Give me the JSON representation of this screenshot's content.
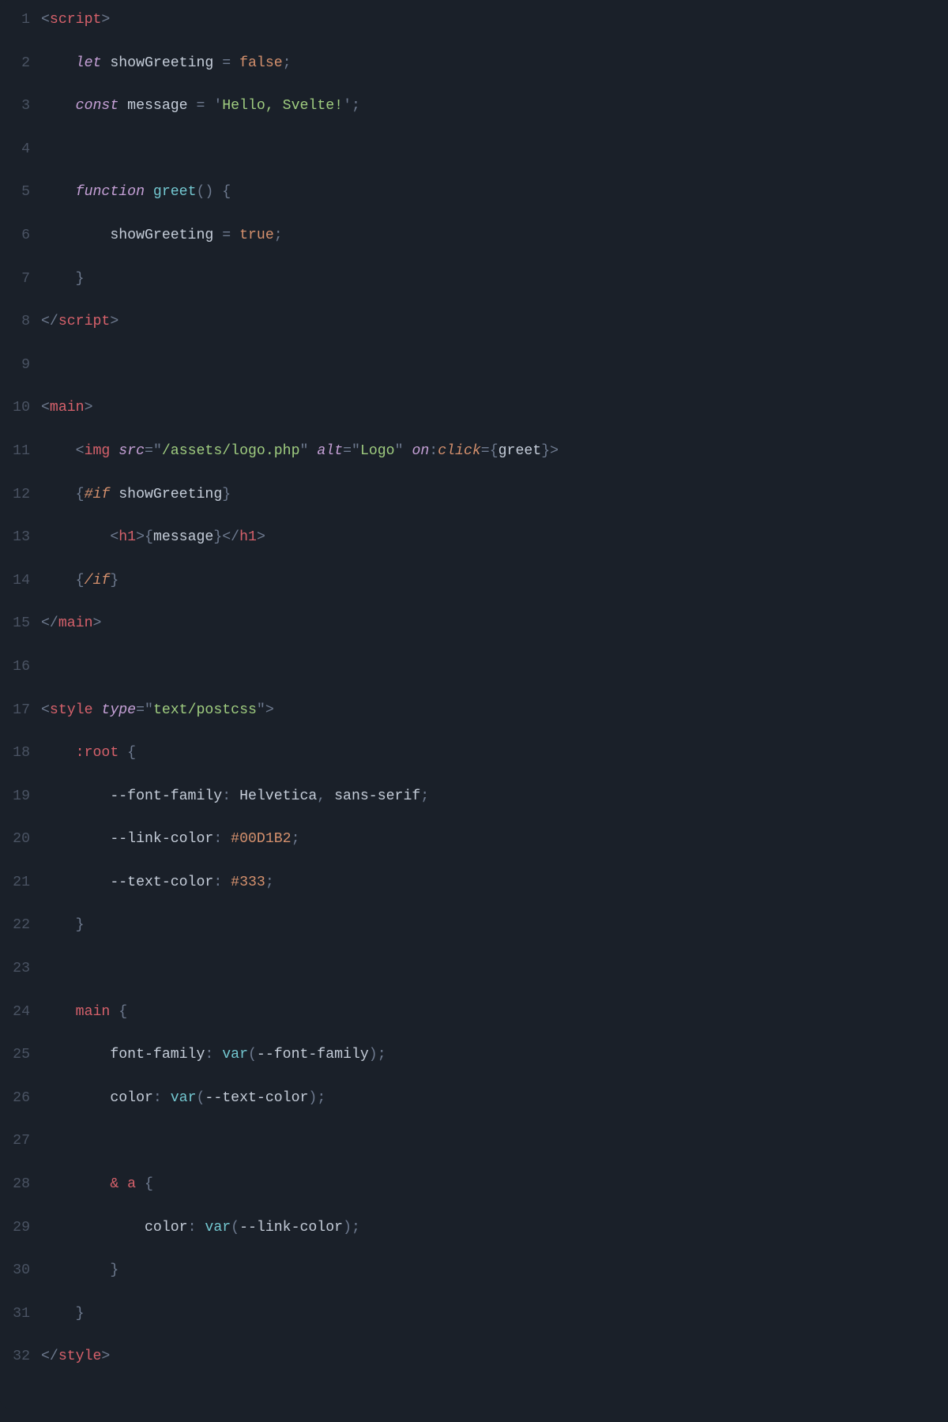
{
  "lines": [
    {
      "n": "1",
      "tokens": [
        [
          "t-angle",
          "<"
        ],
        [
          "t-tag",
          "script"
        ],
        [
          "t-angle",
          ">"
        ]
      ]
    },
    {
      "n": "2",
      "tokens": [
        [
          "",
          "    "
        ],
        [
          "t-keyword",
          "let"
        ],
        [
          "",
          " "
        ],
        [
          "t-ident",
          "showGreeting"
        ],
        [
          "",
          " "
        ],
        [
          "t-op",
          "="
        ],
        [
          "",
          " "
        ],
        [
          "t-bool",
          "false"
        ],
        [
          "t-op",
          ";"
        ]
      ]
    },
    {
      "n": "3",
      "tokens": [
        [
          "",
          "    "
        ],
        [
          "t-keyword",
          "const"
        ],
        [
          "",
          " "
        ],
        [
          "t-ident",
          "message"
        ],
        [
          "",
          " "
        ],
        [
          "t-op",
          "="
        ],
        [
          "",
          " "
        ],
        [
          "t-strq",
          "'"
        ],
        [
          "t-str",
          "Hello, Svelte!"
        ],
        [
          "t-strq",
          "'"
        ],
        [
          "t-op",
          ";"
        ]
      ]
    },
    {
      "n": "4",
      "tokens": []
    },
    {
      "n": "5",
      "tokens": [
        [
          "",
          "    "
        ],
        [
          "t-keyword",
          "function"
        ],
        [
          "",
          " "
        ],
        [
          "t-fn",
          "greet"
        ],
        [
          "t-op",
          "()"
        ],
        [
          "",
          " "
        ],
        [
          "t-op",
          "{"
        ]
      ]
    },
    {
      "n": "6",
      "tokens": [
        [
          "",
          "        "
        ],
        [
          "t-ident",
          "showGreeting"
        ],
        [
          "",
          " "
        ],
        [
          "t-op",
          "="
        ],
        [
          "",
          " "
        ],
        [
          "t-bool",
          "true"
        ],
        [
          "t-op",
          ";"
        ]
      ]
    },
    {
      "n": "7",
      "tokens": [
        [
          "",
          "    "
        ],
        [
          "t-op",
          "}"
        ]
      ]
    },
    {
      "n": "8",
      "tokens": [
        [
          "t-angle",
          "</"
        ],
        [
          "t-tag",
          "script"
        ],
        [
          "t-angle",
          ">"
        ]
      ]
    },
    {
      "n": "9",
      "tokens": []
    },
    {
      "n": "10",
      "tokens": [
        [
          "t-angle",
          "<"
        ],
        [
          "t-tag",
          "main"
        ],
        [
          "t-angle",
          ">"
        ]
      ]
    },
    {
      "n": "11",
      "tokens": [
        [
          "",
          "    "
        ],
        [
          "t-angle",
          "<"
        ],
        [
          "t-tag",
          "img"
        ],
        [
          "",
          " "
        ],
        [
          "t-attr",
          "src"
        ],
        [
          "t-op",
          "="
        ],
        [
          "t-strq",
          "\""
        ],
        [
          "t-str",
          "/assets/logo.php"
        ],
        [
          "t-strq",
          "\""
        ],
        [
          "",
          " "
        ],
        [
          "t-attr",
          "alt"
        ],
        [
          "t-op",
          "="
        ],
        [
          "t-strq",
          "\""
        ],
        [
          "t-str",
          "Logo"
        ],
        [
          "t-strq",
          "\""
        ],
        [
          "",
          " "
        ],
        [
          "t-attr",
          "on"
        ],
        [
          "t-op",
          ":"
        ],
        [
          "t-event",
          "click"
        ],
        [
          "t-op",
          "="
        ],
        [
          "t-brace",
          "{"
        ],
        [
          "t-expr",
          "greet"
        ],
        [
          "t-brace",
          "}"
        ],
        [
          "t-angle",
          ">"
        ]
      ]
    },
    {
      "n": "12",
      "tokens": [
        [
          "",
          "    "
        ],
        [
          "t-brace",
          "{"
        ],
        [
          "t-event",
          "#if"
        ],
        [
          "",
          " "
        ],
        [
          "t-expr",
          "showGreeting"
        ],
        [
          "t-brace",
          "}"
        ]
      ]
    },
    {
      "n": "13",
      "tokens": [
        [
          "",
          "        "
        ],
        [
          "t-angle",
          "<"
        ],
        [
          "t-tag",
          "h1"
        ],
        [
          "t-angle",
          ">"
        ],
        [
          "t-brace",
          "{"
        ],
        [
          "t-expr",
          "message"
        ],
        [
          "t-brace",
          "}"
        ],
        [
          "t-angle",
          "</"
        ],
        [
          "t-tag",
          "h1"
        ],
        [
          "t-angle",
          ">"
        ]
      ]
    },
    {
      "n": "14",
      "tokens": [
        [
          "",
          "    "
        ],
        [
          "t-brace",
          "{"
        ],
        [
          "t-event",
          "/if"
        ],
        [
          "t-brace",
          "}"
        ]
      ]
    },
    {
      "n": "15",
      "tokens": [
        [
          "t-angle",
          "</"
        ],
        [
          "t-tag",
          "main"
        ],
        [
          "t-angle",
          ">"
        ]
      ]
    },
    {
      "n": "16",
      "tokens": []
    },
    {
      "n": "17",
      "tokens": [
        [
          "t-angle",
          "<"
        ],
        [
          "t-tag",
          "style"
        ],
        [
          "",
          " "
        ],
        [
          "t-attr",
          "type"
        ],
        [
          "t-op",
          "="
        ],
        [
          "t-strq",
          "\""
        ],
        [
          "t-str",
          "text/postcss"
        ],
        [
          "t-strq",
          "\""
        ],
        [
          "t-angle",
          ">"
        ]
      ]
    },
    {
      "n": "18",
      "tokens": [
        [
          "",
          "    "
        ],
        [
          "t-css-sel",
          ":root"
        ],
        [
          "",
          " "
        ],
        [
          "t-op",
          "{"
        ]
      ]
    },
    {
      "n": "19",
      "tokens": [
        [
          "",
          "        "
        ],
        [
          "t-css-prop",
          "--font-family"
        ],
        [
          "t-colon",
          ":"
        ],
        [
          "",
          " "
        ],
        [
          "t-css-val",
          "Helvetica"
        ],
        [
          "t-op",
          ","
        ],
        [
          "",
          " "
        ],
        [
          "t-css-val",
          "sans-serif"
        ],
        [
          "t-op",
          ";"
        ]
      ]
    },
    {
      "n": "20",
      "tokens": [
        [
          "",
          "        "
        ],
        [
          "t-css-prop",
          "--link-color"
        ],
        [
          "t-colon",
          ":"
        ],
        [
          "",
          " "
        ],
        [
          "t-css-num",
          "#00D1B2"
        ],
        [
          "t-op",
          ";"
        ]
      ]
    },
    {
      "n": "21",
      "tokens": [
        [
          "",
          "        "
        ],
        [
          "t-css-prop",
          "--text-color"
        ],
        [
          "t-colon",
          ":"
        ],
        [
          "",
          " "
        ],
        [
          "t-css-num",
          "#333"
        ],
        [
          "t-op",
          ";"
        ]
      ]
    },
    {
      "n": "22",
      "tokens": [
        [
          "",
          "    "
        ],
        [
          "t-op",
          "}"
        ]
      ]
    },
    {
      "n": "23",
      "tokens": []
    },
    {
      "n": "24",
      "tokens": [
        [
          "",
          "    "
        ],
        [
          "t-css-sel",
          "main"
        ],
        [
          "",
          " "
        ],
        [
          "t-op",
          "{"
        ]
      ]
    },
    {
      "n": "25",
      "tokens": [
        [
          "",
          "        "
        ],
        [
          "t-css-prop",
          "font-family"
        ],
        [
          "t-colon",
          ":"
        ],
        [
          "",
          " "
        ],
        [
          "t-fn",
          "var"
        ],
        [
          "t-op",
          "("
        ],
        [
          "t-css-prop",
          "--font-family"
        ],
        [
          "t-op",
          ")"
        ],
        [
          "t-op",
          ";"
        ]
      ]
    },
    {
      "n": "26",
      "tokens": [
        [
          "",
          "        "
        ],
        [
          "t-css-prop",
          "color"
        ],
        [
          "t-colon",
          ":"
        ],
        [
          "",
          " "
        ],
        [
          "t-fn",
          "var"
        ],
        [
          "t-op",
          "("
        ],
        [
          "t-css-prop",
          "--text-color"
        ],
        [
          "t-op",
          ")"
        ],
        [
          "t-op",
          ";"
        ]
      ]
    },
    {
      "n": "27",
      "tokens": []
    },
    {
      "n": "28",
      "tokens": [
        [
          "",
          "        "
        ],
        [
          "t-css-sel",
          "&"
        ],
        [
          "",
          " "
        ],
        [
          "t-css-sel",
          "a"
        ],
        [
          "",
          " "
        ],
        [
          "t-op",
          "{"
        ]
      ]
    },
    {
      "n": "29",
      "tokens": [
        [
          "",
          "            "
        ],
        [
          "t-css-prop",
          "color"
        ],
        [
          "t-colon",
          ":"
        ],
        [
          "",
          " "
        ],
        [
          "t-fn",
          "var"
        ],
        [
          "t-op",
          "("
        ],
        [
          "t-css-prop",
          "--link-color"
        ],
        [
          "t-op",
          ")"
        ],
        [
          "t-op",
          ";"
        ]
      ]
    },
    {
      "n": "30",
      "tokens": [
        [
          "",
          "        "
        ],
        [
          "t-op",
          "}"
        ]
      ]
    },
    {
      "n": "31",
      "tokens": [
        [
          "",
          "    "
        ],
        [
          "t-op",
          "}"
        ]
      ]
    },
    {
      "n": "32",
      "tokens": [
        [
          "t-angle",
          "</"
        ],
        [
          "t-tag",
          "style"
        ],
        [
          "t-angle",
          ">"
        ]
      ]
    }
  ]
}
